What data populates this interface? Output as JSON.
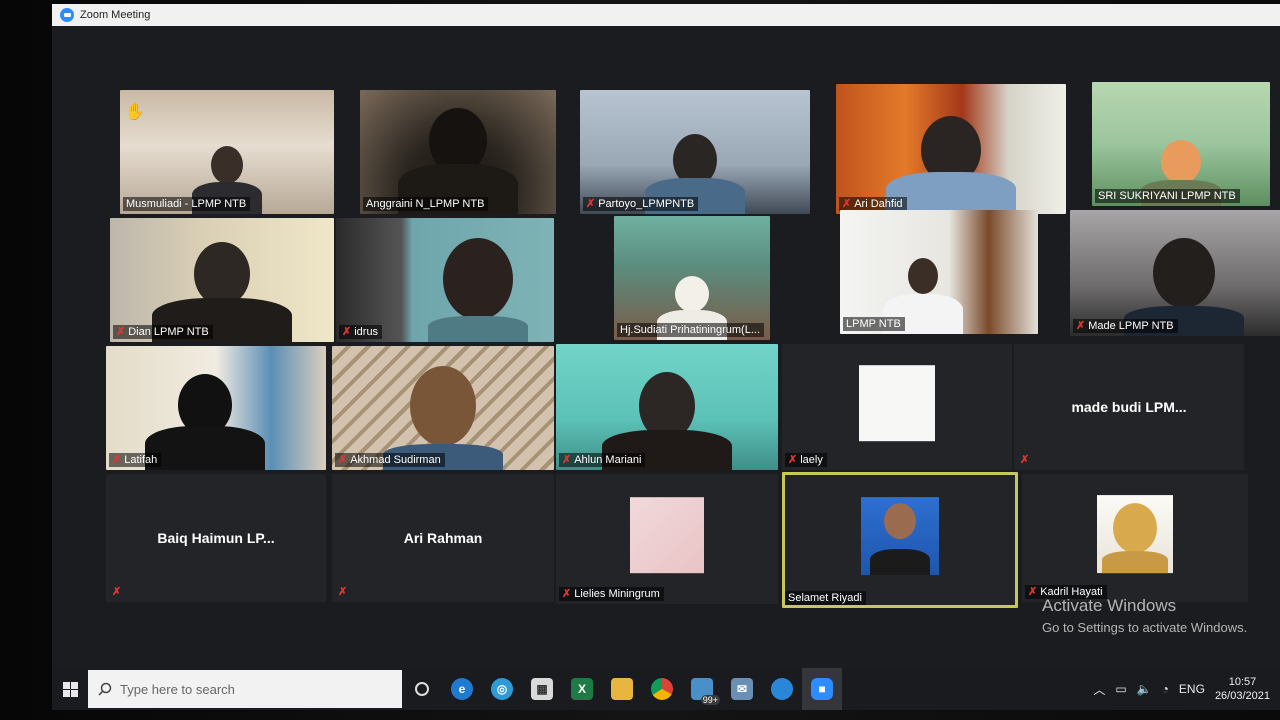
{
  "window": {
    "title": "Zoom Meeting"
  },
  "participants": [
    {
      "name": "Musmuliadi - LPMP NTB",
      "muted": false,
      "hand_raised": true
    },
    {
      "name": "Anggraini N_LPMP NTB",
      "muted": false
    },
    {
      "name": "Partoyo_LPMPNTB",
      "muted": true
    },
    {
      "name": "Ari Dahfid",
      "muted": true
    },
    {
      "name": "SRI SUKRIYANI LPMP NTB",
      "muted": false
    },
    {
      "name": "Dian LPMP NTB",
      "muted": true
    },
    {
      "name": "idrus",
      "muted": true
    },
    {
      "name": "Hj.Sudiati Prihatiningrum(L...",
      "muted": false
    },
    {
      "name": "LPMP NTB",
      "muted": false
    },
    {
      "name": "Made  LPMP NTB",
      "muted": true
    },
    {
      "name": "Latifah",
      "muted": true
    },
    {
      "name": "Akhmad Sudirman",
      "muted": true
    },
    {
      "name": "Ahlun Mariani",
      "muted": true
    },
    {
      "name": "laely",
      "muted": true
    },
    {
      "name": "made budi LPM...",
      "muted": true
    },
    {
      "name": "Baiq Haimun LP...",
      "muted": true
    },
    {
      "name": "Ari Rahman",
      "muted": true
    },
    {
      "name": "Lielies Miningrum",
      "muted": true
    },
    {
      "name": "Selamet Riyadi",
      "muted": false,
      "active_speaker": true
    },
    {
      "name": "Kadril Hayati",
      "muted": true
    }
  ],
  "watermark": {
    "line1": "Activate Windows",
    "line2": "Go to Settings to activate Windows."
  },
  "taskbar": {
    "search_placeholder": "Type here to search",
    "notification_badge": "99+",
    "language": "ENG",
    "time": "10:57",
    "date": "26/03/2021"
  },
  "colors": {
    "active_speaker_border": "#c8c75a",
    "muted_icon": "#e0362f",
    "zoom_blue": "#2d8cff"
  }
}
